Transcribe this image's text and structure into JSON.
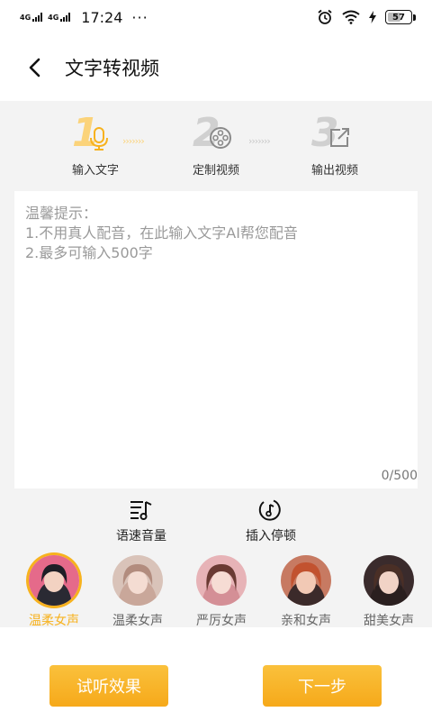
{
  "status_bar": {
    "net1": "4G",
    "net1_sup": "HD",
    "net2": "4G",
    "net2_sup": "HD",
    "time": "17:24",
    "more": "···",
    "battery": "57"
  },
  "header": {
    "title": "文字转视频"
  },
  "steps": [
    {
      "number": "1",
      "label": "输入文字"
    },
    {
      "number": "2",
      "label": "定制视频"
    },
    {
      "number": "3",
      "label": "输出视频"
    }
  ],
  "step_arrows": "›››››››",
  "text_input": {
    "placeholder": "温馨提示：\n1.不用真人配音，在此输入文字AI帮您配音\n2.最多可输入500字",
    "counter": "0/500"
  },
  "tools": [
    {
      "label": "语速音量",
      "icon": "speed-volume-icon"
    },
    {
      "label": "插入停顿",
      "icon": "pause-icon"
    }
  ],
  "voices": [
    {
      "label": "温柔女声",
      "selected": true
    },
    {
      "label": "温柔女声",
      "selected": false
    },
    {
      "label": "严厉女声",
      "selected": false
    },
    {
      "label": "亲和女声",
      "selected": false
    },
    {
      "label": "甜美女声",
      "selected": false
    }
  ],
  "buttons": {
    "preview": "试听效果",
    "next": "下一步"
  },
  "colors": {
    "accent": "#f7b21e",
    "step_active": "#fbd37a",
    "step_inactive": "#c4c4c4",
    "placeholder": "#9a9a9a"
  }
}
